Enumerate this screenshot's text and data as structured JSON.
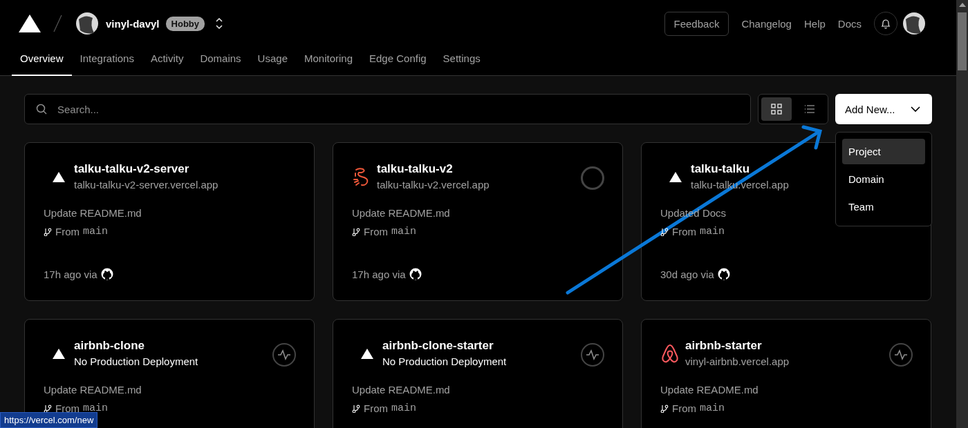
{
  "header": {
    "team_name": "vinyl-davyl",
    "plan_badge": "Hobby",
    "links": [
      {
        "label": "Feedback",
        "kind": "outlined"
      },
      {
        "label": "Changelog",
        "kind": "plain"
      },
      {
        "label": "Help",
        "kind": "plain"
      },
      {
        "label": "Docs",
        "kind": "plain"
      }
    ]
  },
  "tabs": [
    {
      "label": "Overview",
      "selected": true
    },
    {
      "label": "Integrations",
      "selected": false
    },
    {
      "label": "Activity",
      "selected": false
    },
    {
      "label": "Domains",
      "selected": false
    },
    {
      "label": "Usage",
      "selected": false
    },
    {
      "label": "Monitoring",
      "selected": false
    },
    {
      "label": "Edge Config",
      "selected": false
    },
    {
      "label": "Settings",
      "selected": false
    }
  ],
  "search": {
    "placeholder": "Search..."
  },
  "view_toggle": [
    {
      "kind": "grid",
      "selected": true
    },
    {
      "kind": "list",
      "selected": false
    }
  ],
  "add_new": {
    "label": "Add New...",
    "expanded": true,
    "menu": [
      {
        "label": "Project",
        "selected": true
      },
      {
        "label": "Domain",
        "selected": false
      },
      {
        "label": "Team",
        "selected": false
      }
    ]
  },
  "projects": [
    {
      "name": "talku-talku-v2-server",
      "logo": {
        "kind": "triangle"
      },
      "subtitle": {
        "kind": "url",
        "text": "talku-talku-v2-server.vercel.app"
      },
      "commit": "Update README.md",
      "branch_label": "From",
      "branch": "main",
      "time": "17h ago via"
    },
    {
      "name": "talku-talku-v2",
      "logo": {
        "kind": "squiggle"
      },
      "subtitle": {
        "kind": "url",
        "text": "talku-talku-v2.vercel.app"
      },
      "commit": "Update README.md",
      "branch_label": "From",
      "branch": "main",
      "time": "17h ago via",
      "status": {
        "kind": "empty"
      }
    },
    {
      "name": "talku-talku",
      "logo": {
        "kind": "triangle"
      },
      "subtitle": {
        "kind": "url",
        "text": "talku-talku.vercel.app"
      },
      "commit": "Updated Docs",
      "branch_label": "From",
      "branch": "main",
      "time": "30d ago via"
    },
    {
      "name": "airbnb-clone",
      "logo": {
        "kind": "triangle"
      },
      "subtitle": {
        "kind": "notice",
        "text": "No Production Deployment"
      },
      "commit": "Update README.md",
      "branch_label": "From",
      "branch": "main",
      "status": {
        "kind": "activity"
      }
    },
    {
      "name": "airbnb-clone-starter",
      "logo": {
        "kind": "triangle"
      },
      "subtitle": {
        "kind": "notice",
        "text": "No Production Deployment"
      },
      "commit": "Update README.md",
      "branch_label": "From",
      "branch": "main",
      "status": {
        "kind": "activity"
      }
    },
    {
      "name": "airbnb-starter",
      "logo": {
        "kind": "airbnb"
      },
      "subtitle": {
        "kind": "url",
        "text": "vinyl-airbnb.vercel.app"
      },
      "commit": "Update README.md",
      "branch_label": "From",
      "branch": "main",
      "status": {
        "kind": "activity"
      }
    }
  ],
  "status_link": "https://vercel.com/new"
}
